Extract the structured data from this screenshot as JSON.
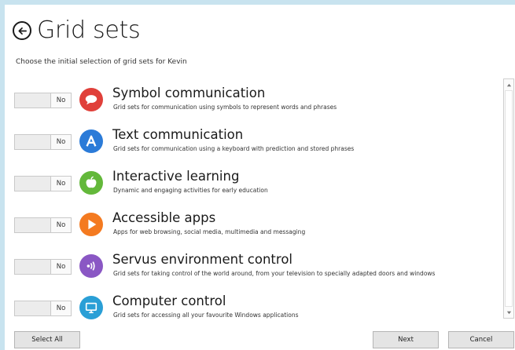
{
  "header": {
    "title": "Grid sets",
    "subtitle": "Choose the initial selection of grid sets for Kevin"
  },
  "grid_sets": [
    {
      "name": "Symbol communication",
      "description": "Grid sets for communication using symbols to represent words and phrases",
      "toggle": "No",
      "color": "#e0403a",
      "icon": "speech-bubble-icon"
    },
    {
      "name": "Text communication",
      "description": "Grid sets for communication using a keyboard with prediction and stored phrases",
      "toggle": "No",
      "color": "#2b7bd8",
      "icon": "letter-a-icon"
    },
    {
      "name": "Interactive learning",
      "description": "Dynamic and engaging activities for early education",
      "toggle": "No",
      "color": "#63b83a",
      "icon": "apple-icon"
    },
    {
      "name": "Accessible apps",
      "description": "Apps for web browsing, social media, multimedia and messaging",
      "toggle": "No",
      "color": "#f47a20",
      "icon": "play-icon"
    },
    {
      "name": "Servus environment control",
      "description": "Grid sets for taking control of the world around, from your television to specially adapted doors and windows",
      "toggle": "No",
      "color": "#8a57c4",
      "icon": "signal-waves-icon"
    },
    {
      "name": "Computer control",
      "description": "Grid sets for accessing all your favourite Windows applications",
      "toggle": "No",
      "color": "#2a9fd6",
      "icon": "monitor-icon"
    }
  ],
  "buttons": {
    "select_all": "Select All",
    "next": "Next",
    "cancel": "Cancel"
  },
  "colors": {
    "background": "#c8e3ef",
    "panel": "#ffffff"
  }
}
